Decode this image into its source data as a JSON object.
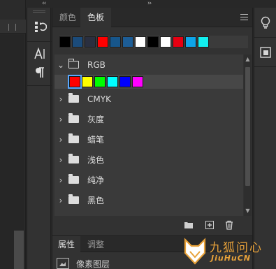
{
  "colors": {
    "accent_selected": "#58a7ff",
    "watermark": "#e8a23a"
  },
  "panel_tabs": [
    {
      "label": "颜色",
      "active": false
    },
    {
      "label": "色板",
      "active": true
    }
  ],
  "recent_swatches": [
    "#000000",
    "#1b4b7a",
    "#2a2f3f",
    "#ff0000",
    "#17568b",
    "#1d5d96",
    "#ffffff",
    "#000000",
    "#ffffff",
    "#e60012",
    "#0ea5e9",
    "#12f0f0"
  ],
  "groups": [
    {
      "name": "RGB",
      "expanded": true,
      "swatches": [
        "#ff0000",
        "#ffff00",
        "#00ff00",
        "#00ffff",
        "#0000ff",
        "#ff00ff"
      ]
    },
    {
      "name": "CMYK",
      "expanded": false
    },
    {
      "name": "灰度",
      "expanded": false
    },
    {
      "name": "蜡笔",
      "expanded": false
    },
    {
      "name": "浅色",
      "expanded": false
    },
    {
      "name": "纯净",
      "expanded": false
    },
    {
      "name": "黑色",
      "expanded": false
    }
  ],
  "lower_tabs": [
    {
      "label": "属性",
      "active": true
    },
    {
      "label": "调整",
      "active": false
    }
  ],
  "properties": {
    "label": "像素图层"
  },
  "watermark": {
    "line1": "九狐问心",
    "line2": "JiuHuCN"
  }
}
